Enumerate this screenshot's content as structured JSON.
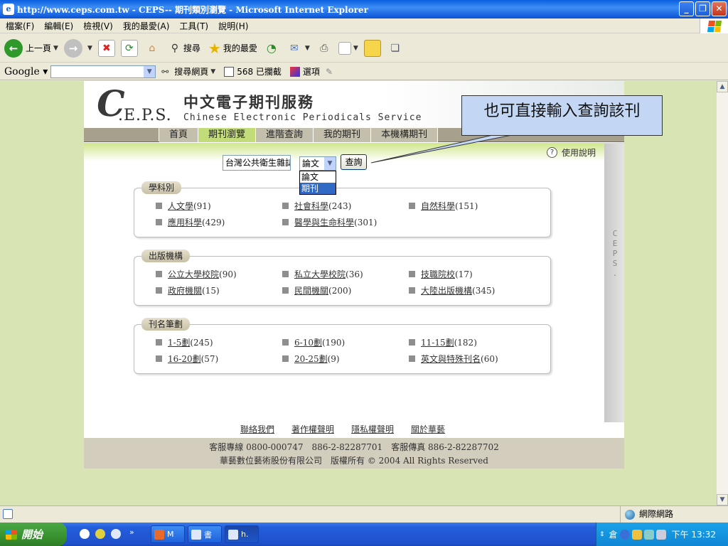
{
  "window": {
    "title": "http://www.ceps.com.tw - CEPS-- 期刊類別瀏覽 - Microsoft Internet Explorer",
    "minimize": "_",
    "maximize": "❐",
    "close": "✕"
  },
  "menu": [
    "檔案(F)",
    "編輯(E)",
    "檢視(V)",
    "我的最愛(A)",
    "工具(T)",
    "說明(H)"
  ],
  "toolbar": {
    "back_label": "上一頁",
    "search_label": "搜尋",
    "favorites_label": "我的最愛"
  },
  "google_bar": {
    "logo": "Google",
    "search_web": "搜尋網頁",
    "blocked": "568 已攔截",
    "options": "選項"
  },
  "site": {
    "title": "中文電子期刊服務",
    "subtitle": "Chinese Electronic Periodicals Service",
    "logo_c": "C",
    "logo_rest": ".E.P.S.",
    "nav": [
      "首頁",
      "期刊瀏覽",
      "進階查詢",
      "我的期刊",
      "本機構期刊"
    ],
    "help": "使用說明",
    "side_tab": "C E P S ."
  },
  "search": {
    "query_value": "台灣公共衛生雜誌",
    "select_value": "論文",
    "options": [
      "論文",
      "期刊"
    ],
    "button": "查詢"
  },
  "groups": [
    {
      "title": "學科別",
      "items": [
        {
          "label": "人文學",
          "count": "(91)"
        },
        {
          "label": "社會科學",
          "count": "(243)"
        },
        {
          "label": "自然科學",
          "count": "(151)"
        },
        {
          "label": "應用科學",
          "count": "(429)"
        },
        {
          "label": "醫學與生命科學",
          "count": "(301)"
        }
      ]
    },
    {
      "title": "出版機構",
      "items": [
        {
          "label": "公立大學校院",
          "count": "(90)"
        },
        {
          "label": "私立大學校院",
          "count": "(36)"
        },
        {
          "label": "技職院校",
          "count": "(17)"
        },
        {
          "label": "政府機關",
          "count": "(15)"
        },
        {
          "label": "民間機關",
          "count": "(200)"
        },
        {
          "label": "大陸出版機構",
          "count": "(345)"
        }
      ]
    },
    {
      "title": "刊名筆劃",
      "items": [
        {
          "label": "1-5劃",
          "count": "(245)"
        },
        {
          "label": "6-10劃",
          "count": "(190)"
        },
        {
          "label": "11-15劃",
          "count": "(182)"
        },
        {
          "label": "16-20劃",
          "count": "(57)"
        },
        {
          "label": "20-25劃",
          "count": "(9)"
        },
        {
          "label": "英文與特殊刊名",
          "count": "(60)"
        }
      ]
    }
  ],
  "footer_links": [
    "聯絡我們",
    "著作權聲明",
    "隱私權聲明",
    "關於華藝"
  ],
  "footer": {
    "line1": "客服專線 0800-000747　886-2-82287701　客服傳真 886-2-82287702",
    "line2": "華藝數位藝術股份有限公司　版權所有 © 2004 All Rights Reserved"
  },
  "callout": "也可直接輸入查詢該刊",
  "status": {
    "zone": "網際網路"
  },
  "taskbar": {
    "start": "開始",
    "items": [
      "M",
      "書",
      "h."
    ],
    "clock": "下午 13:32",
    "ime": "倉"
  },
  "colors": {
    "title_blue": "#0a5fe0",
    "nav_active": "#c3dc7a",
    "page_bg": "#d8e4b4",
    "callout_bg": "#c3d6f3"
  }
}
